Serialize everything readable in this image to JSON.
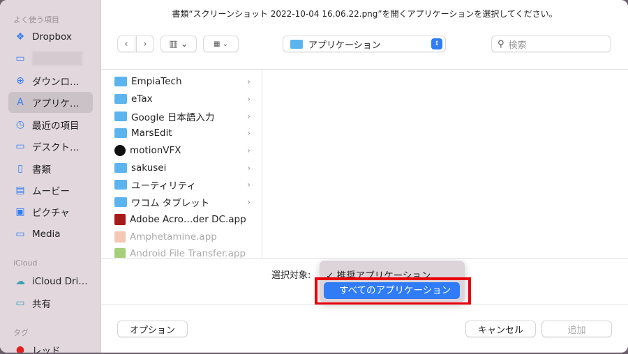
{
  "title": "書類“スクリーンショット 2022-10-04 16.06.22.png”を開くアプリケーションを選択してください。",
  "sidebar": {
    "favorites_header": "よく使う項目",
    "items": [
      {
        "label": "Dropbox",
        "icon": "dropbox-icon"
      },
      {
        "label": "",
        "icon": "folder-icon"
      },
      {
        "label": "ダウンロ…",
        "icon": "download-icon"
      },
      {
        "label": "アプリケ…",
        "icon": "applications-icon"
      },
      {
        "label": "最近の項目",
        "icon": "clock-icon"
      },
      {
        "label": "デスクト…",
        "icon": "desktop-icon"
      },
      {
        "label": "書類",
        "icon": "document-icon"
      },
      {
        "label": "ムービー",
        "icon": "film-icon"
      },
      {
        "label": "ピクチャ",
        "icon": "picture-icon"
      },
      {
        "label": "Media",
        "icon": "folder-icon"
      }
    ],
    "icloud_header": "iCloud",
    "icloud_items": [
      {
        "label": "iCloud Dri…"
      },
      {
        "label": "共有"
      }
    ],
    "tags_header": "タグ",
    "tags": [
      {
        "label": "レッド",
        "color": "#e0201e"
      }
    ]
  },
  "toolbar": {
    "location": "アプリケーション",
    "search_placeholder": "検索"
  },
  "files": [
    {
      "name": "EmpiaTech",
      "folder": true
    },
    {
      "name": "eTax",
      "folder": true
    },
    {
      "name": "Google 日本語入力",
      "folder": true
    },
    {
      "name": "MarsEdit",
      "folder": true
    },
    {
      "name": "motionVFX",
      "folder": true
    },
    {
      "name": "sakusei",
      "folder": true
    },
    {
      "name": "ユーティリティ",
      "folder": true
    },
    {
      "name": "ワコム タブレット",
      "folder": true
    },
    {
      "name": "Adobe Acro…der DC.app",
      "folder": false
    },
    {
      "name": "Amphetamine.app",
      "folder": false
    },
    {
      "name": "Android File Transfer.app",
      "folder": false
    }
  ],
  "filter": {
    "label": "選択対象:",
    "options": [
      "推奨アプリケーション",
      "すべてのアプリケーション"
    ],
    "check": "✓"
  },
  "buttons": {
    "options": "オプション",
    "cancel": "キャンセル",
    "add": "追加"
  },
  "colors": {
    "accent": "#2f7cf6",
    "highlight": "#e8000b"
  }
}
